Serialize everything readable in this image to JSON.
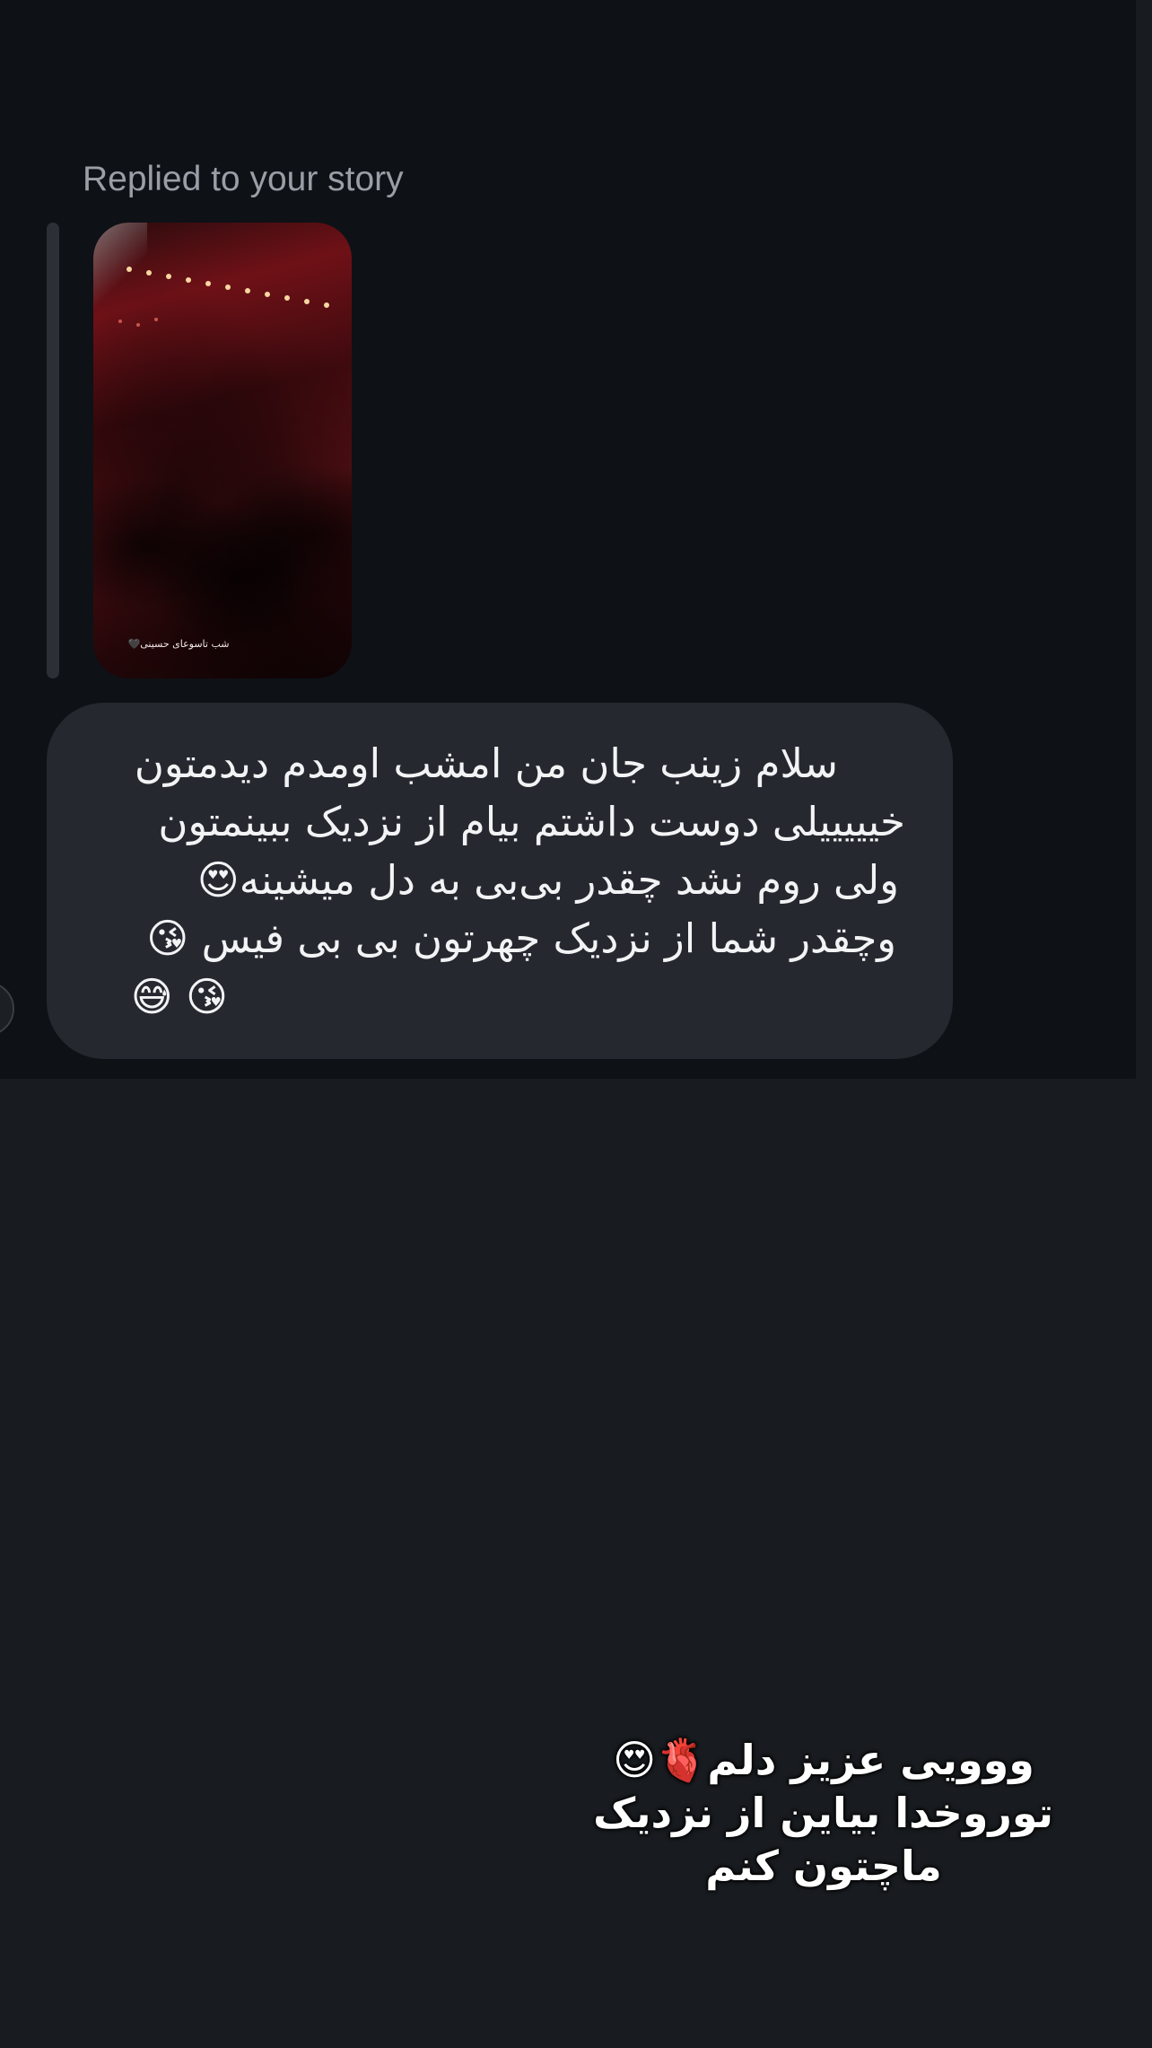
{
  "reply_context": {
    "caption": "Replied to your story",
    "story_overlay_text": "شب تاسوعای حسینی🖤"
  },
  "message": {
    "lines": [
      "سلام زینب جان من امشب اومدم دیدمتون",
      "خیییییلی دوست داشتم بیام از نزدیک ببینمتون",
      "ولی روم نشد چقدر بی‌بی به دل میشینه😍",
      "وچقدر شما از نزدیک چهرتون بی بی فیس 😘",
      "😘 😅"
    ]
  },
  "story_text_overlay": {
    "lines": [
      "ووویی عزیز دلم🫀😍",
      "توروخدا بیاین از نزدیک",
      "ماچتون کنم"
    ]
  },
  "colors": {
    "page_background": "#181b1f",
    "chat_background": "#0e1116",
    "bubble_background": "#25282e",
    "caption_text": "#9a9ea6",
    "message_text": "#f2f3f5"
  }
}
